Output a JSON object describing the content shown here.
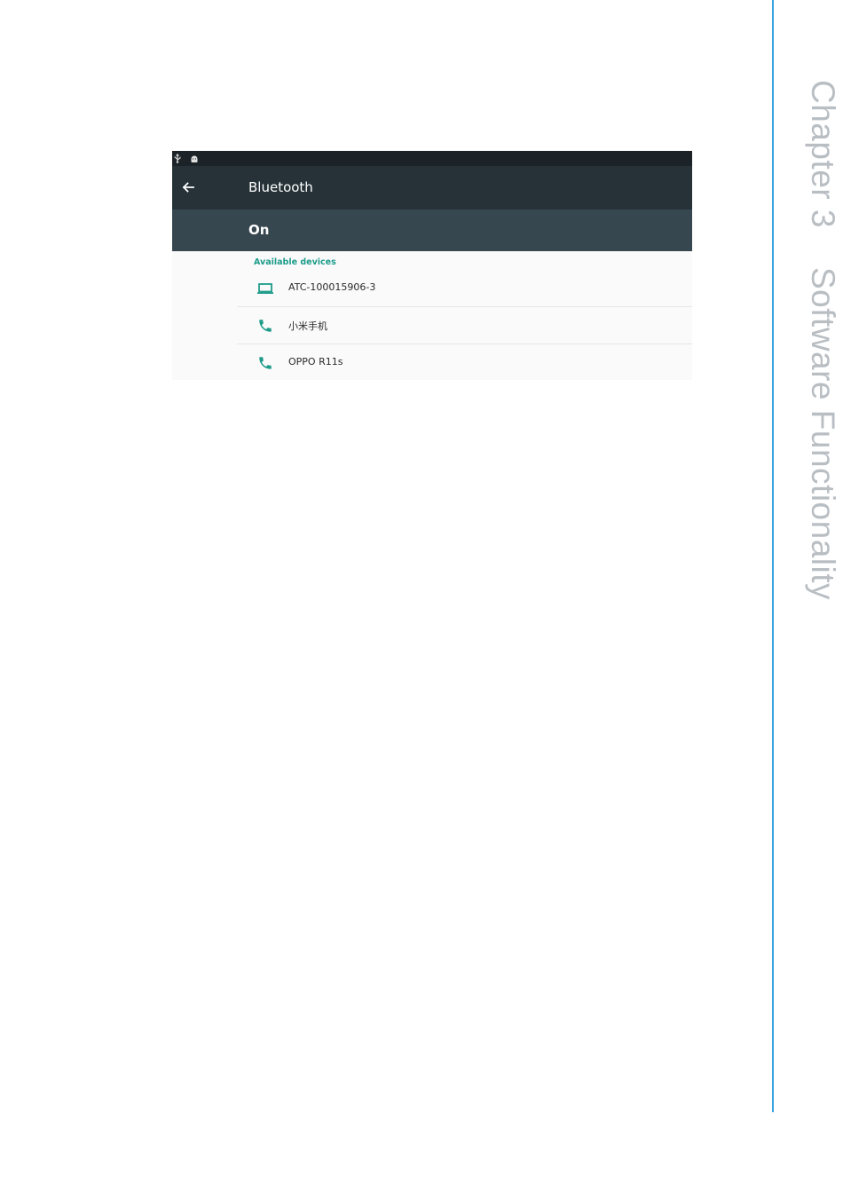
{
  "sidebar_tab": {
    "chapter": "Chapter 3",
    "title": "Software Functionality"
  },
  "screen": {
    "status_icons": [
      "usb-icon",
      "android-icon"
    ],
    "appbar": {
      "back_icon": "arrow-left-icon",
      "title": "Bluetooth"
    },
    "switch": {
      "state_label": "On"
    },
    "section_header": "Available devices",
    "devices": [
      {
        "icon": "laptop-icon",
        "name": "ATC-100015906-3"
      },
      {
        "icon": "phone-icon",
        "name": "小米手机"
      },
      {
        "icon": "phone-icon",
        "name": "OPPO R11s"
      }
    ]
  },
  "colors": {
    "statusbar": "#1c2328",
    "appbar": "#263238",
    "switchbar": "#37474f",
    "accent": "#1e9c8a",
    "side_rule": "#3aa3e3"
  }
}
